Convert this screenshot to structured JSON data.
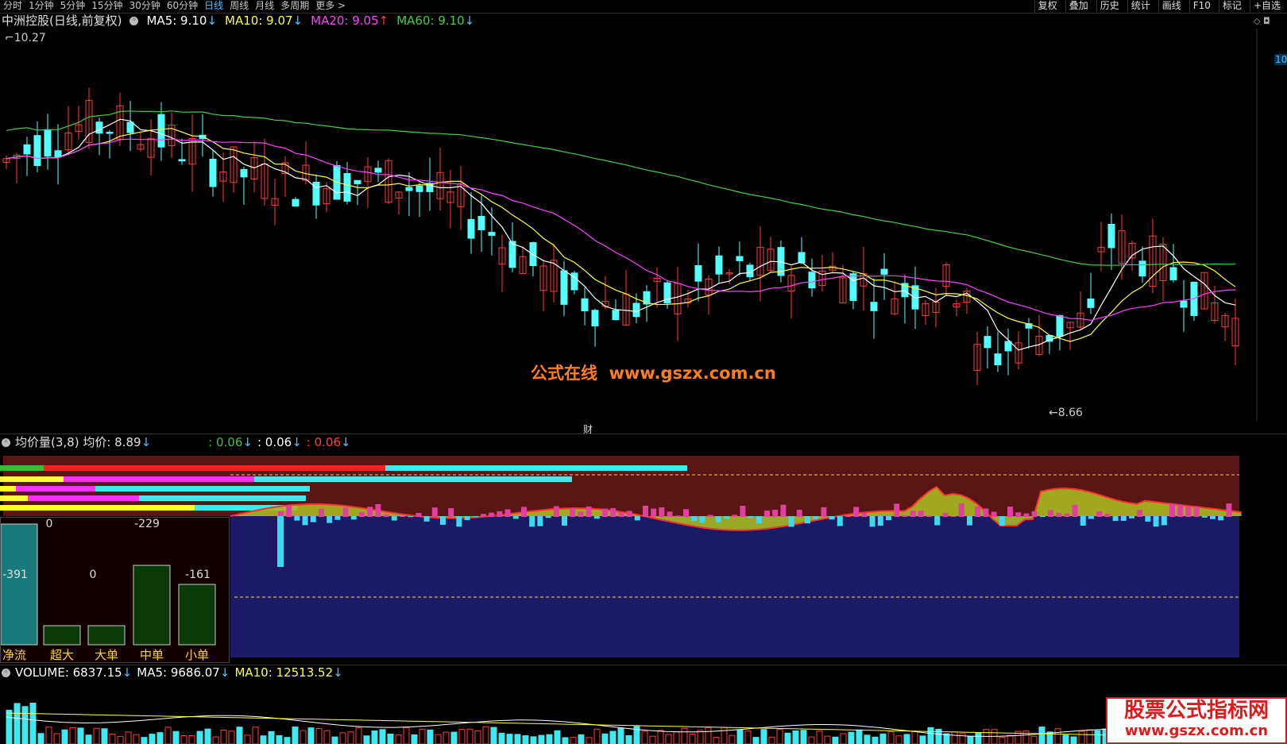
{
  "topbar": {
    "periods": [
      "分时",
      "1分钟",
      "5分钟",
      "15分钟",
      "30分钟",
      "60分钟",
      "日线",
      "周线",
      "月线",
      "多周期",
      "更多 >"
    ],
    "active_period": "日线",
    "actions": [
      "复权",
      "叠加",
      "历史",
      "统计",
      "画线",
      "F10",
      "标记",
      "+自选"
    ]
  },
  "main_chart": {
    "title": "中洲控股(日线,前复权)",
    "ma5_label": "MA5: 9.10",
    "ma10_label": "MA10: 9.07",
    "ma20_label": "MA20: 9.05",
    "ma60_label": "MA60: 9.10",
    "ma5_color": "#ffffff",
    "ma10_color": "#ffff40",
    "ma20_color": "#ff40ff",
    "ma60_color": "#40d040",
    "high_label": "10.27",
    "low_label": "8.66",
    "right_axis_label": "10",
    "cai_marker": "财",
    "watermark_cn": "公式在线",
    "watermark_url": "www.gszx.com.cn",
    "up_color": "#ff3b3b",
    "down_color": "#54ffff"
  },
  "indicator": {
    "title": "均价量(3,8) 均价: 8.89",
    "v1": ": 0.06",
    "v2": ": 0.06",
    "v3": ": 0.06",
    "v1_color": "#40c040",
    "v2_color": "#ffffff",
    "v3_color": "#ff4040"
  },
  "fund_flow": {
    "labels": [
      "净流",
      "超大",
      "大单",
      "中单",
      "小单"
    ],
    "values": [
      "-391",
      "0",
      "0",
      "-229",
      "-161"
    ]
  },
  "volume": {
    "volume_label": "VOLUME: 6837.15",
    "ma5_label": "MA5: 9686.07",
    "ma10_label": "MA10: 12513.52"
  },
  "brand": {
    "line1": "股票公式指标网",
    "line2": "www.gszx.com.cn"
  }
}
